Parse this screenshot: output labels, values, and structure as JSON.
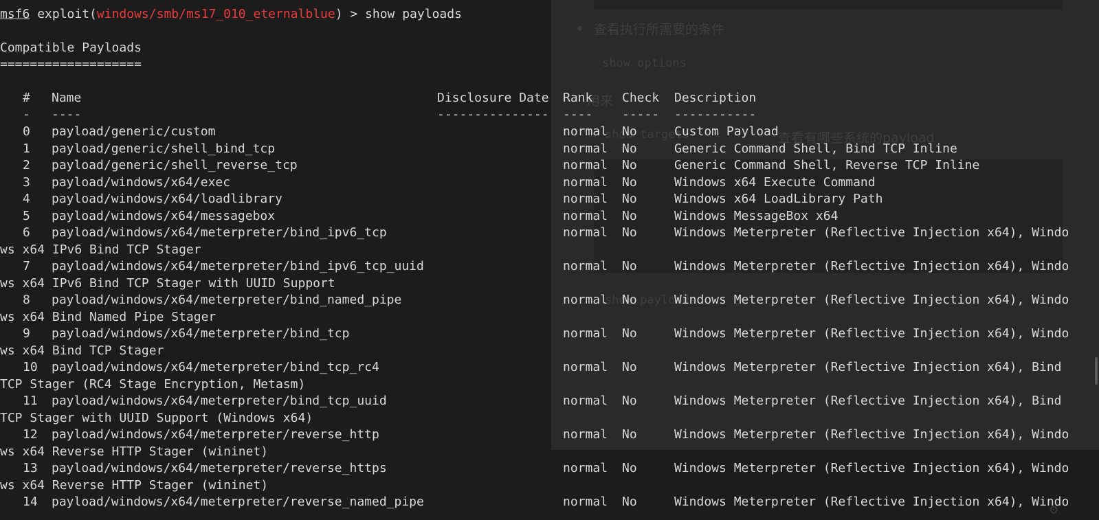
{
  "background_doc": {
    "bullet1": "查看执行所需要的条件",
    "code1": "show options",
    "item2": "用来",
    "item3": "show targets",
    "item3b": "查看有哪些系统的payload",
    "item4": "show payloads"
  },
  "prompt": {
    "msf": "msf6",
    "text_before": " exploit(",
    "module": "windows/smb/ms17_010_eternalblue",
    "text_after": ") > show payloads"
  },
  "section": {
    "title": "Compatible Payloads",
    "underline": "==================="
  },
  "columns": {
    "num": "#",
    "name": "Name",
    "date": "Disclosure Date",
    "rank": "Rank",
    "check": "Check",
    "desc": "Description",
    "num_sep": "-",
    "name_sep": "----",
    "date_sep": "---------------",
    "rank_sep": "----",
    "check_sep": "-----",
    "desc_sep": "-----------"
  },
  "rows": [
    {
      "num": "0",
      "name": "payload/generic/custom",
      "rank": "normal",
      "check": "No",
      "desc": "Custom Payload",
      "cont": ""
    },
    {
      "num": "1",
      "name": "payload/generic/shell_bind_tcp",
      "rank": "normal",
      "check": "No",
      "desc": "Generic Command Shell, Bind TCP Inline",
      "cont": ""
    },
    {
      "num": "2",
      "name": "payload/generic/shell_reverse_tcp",
      "rank": "normal",
      "check": "No",
      "desc": "Generic Command Shell, Reverse TCP Inline",
      "cont": ""
    },
    {
      "num": "3",
      "name": "payload/windows/x64/exec",
      "rank": "normal",
      "check": "No",
      "desc": "Windows x64 Execute Command",
      "cont": ""
    },
    {
      "num": "4",
      "name": "payload/windows/x64/loadlibrary",
      "rank": "normal",
      "check": "No",
      "desc": "Windows x64 LoadLibrary Path",
      "cont": ""
    },
    {
      "num": "5",
      "name": "payload/windows/x64/messagebox",
      "rank": "normal",
      "check": "No",
      "desc": "Windows MessageBox x64",
      "cont": ""
    },
    {
      "num": "6",
      "name": "payload/windows/x64/meterpreter/bind_ipv6_tcp",
      "rank": "normal",
      "check": "No",
      "desc": "Windows Meterpreter (Reflective Injection x64), Windo",
      "cont": "ws x64 IPv6 Bind TCP Stager"
    },
    {
      "num": "7",
      "name": "payload/windows/x64/meterpreter/bind_ipv6_tcp_uuid",
      "rank": "normal",
      "check": "No",
      "desc": "Windows Meterpreter (Reflective Injection x64), Windo",
      "cont": "ws x64 IPv6 Bind TCP Stager with UUID Support"
    },
    {
      "num": "8",
      "name": "payload/windows/x64/meterpreter/bind_named_pipe",
      "rank": "normal",
      "check": "No",
      "desc": "Windows Meterpreter (Reflective Injection x64), Windo",
      "cont": "ws x64 Bind Named Pipe Stager"
    },
    {
      "num": "9",
      "name": "payload/windows/x64/meterpreter/bind_tcp",
      "rank": "normal",
      "check": "No",
      "desc": "Windows Meterpreter (Reflective Injection x64), Windo",
      "cont": "ws x64 Bind TCP Stager"
    },
    {
      "num": "10",
      "name": "payload/windows/x64/meterpreter/bind_tcp_rc4",
      "rank": "normal",
      "check": "No",
      "desc": "Windows Meterpreter (Reflective Injection x64), Bind",
      "cont": "TCP Stager (RC4 Stage Encryption, Metasm)"
    },
    {
      "num": "11",
      "name": "payload/windows/x64/meterpreter/bind_tcp_uuid",
      "rank": "normal",
      "check": "No",
      "desc": "Windows Meterpreter (Reflective Injection x64), Bind",
      "cont": "TCP Stager with UUID Support (Windows x64)"
    },
    {
      "num": "12",
      "name": "payload/windows/x64/meterpreter/reverse_http",
      "rank": "normal",
      "check": "No",
      "desc": "Windows Meterpreter (Reflective Injection x64), Windo",
      "cont": "ws x64 Reverse HTTP Stager (wininet)"
    },
    {
      "num": "13",
      "name": "payload/windows/x64/meterpreter/reverse_https",
      "rank": "normal",
      "check": "No",
      "desc": "Windows Meterpreter (Reflective Injection x64), Windo",
      "cont": "ws x64 Reverse HTTP Stager (wininet)"
    },
    {
      "num": "14",
      "name": "payload/windows/x64/meterpreter/reverse_named_pipe",
      "rank": "normal",
      "check": "No",
      "desc": "Windows Meterpreter (Reflective Injection x64), Windo",
      "cont": ""
    }
  ]
}
